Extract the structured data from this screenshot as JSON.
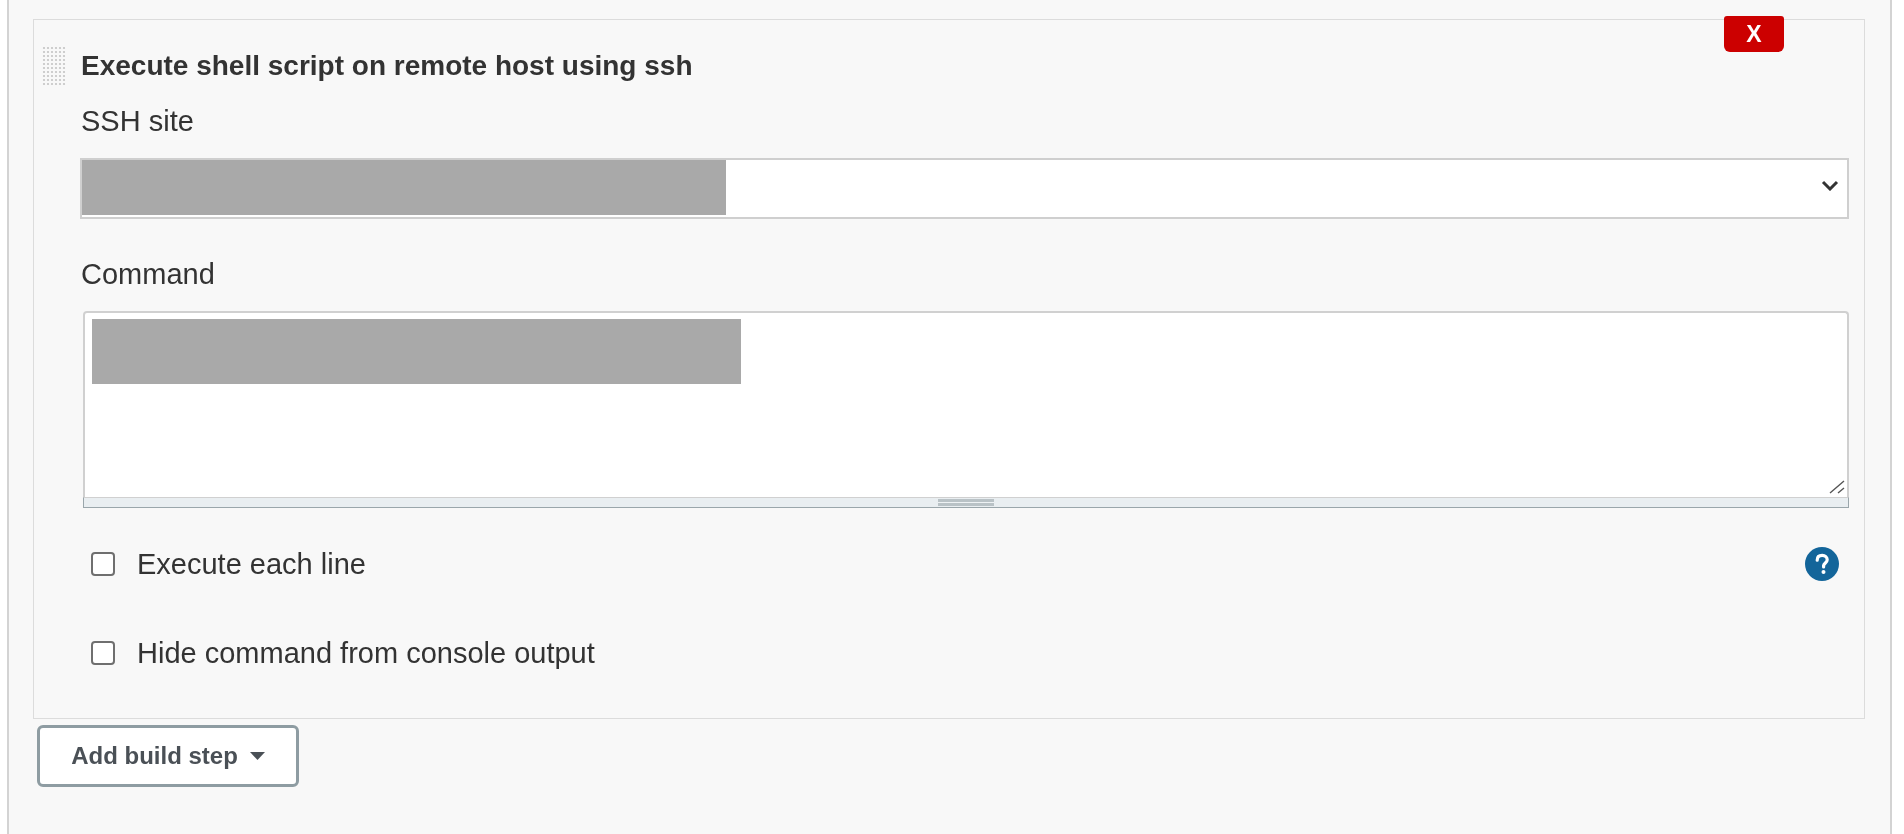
{
  "step": {
    "title": "Execute shell script on remote host using ssh",
    "delete_button": "X",
    "ssh_site": {
      "label": "SSH site",
      "redacted": true
    },
    "command": {
      "label": "Command",
      "redacted": true
    },
    "options": [
      {
        "label": "Execute each line",
        "checked": false,
        "help": true
      },
      {
        "label": "Hide command from console output",
        "checked": false,
        "help": false
      }
    ]
  },
  "add_button": {
    "label": "Add build step"
  }
}
